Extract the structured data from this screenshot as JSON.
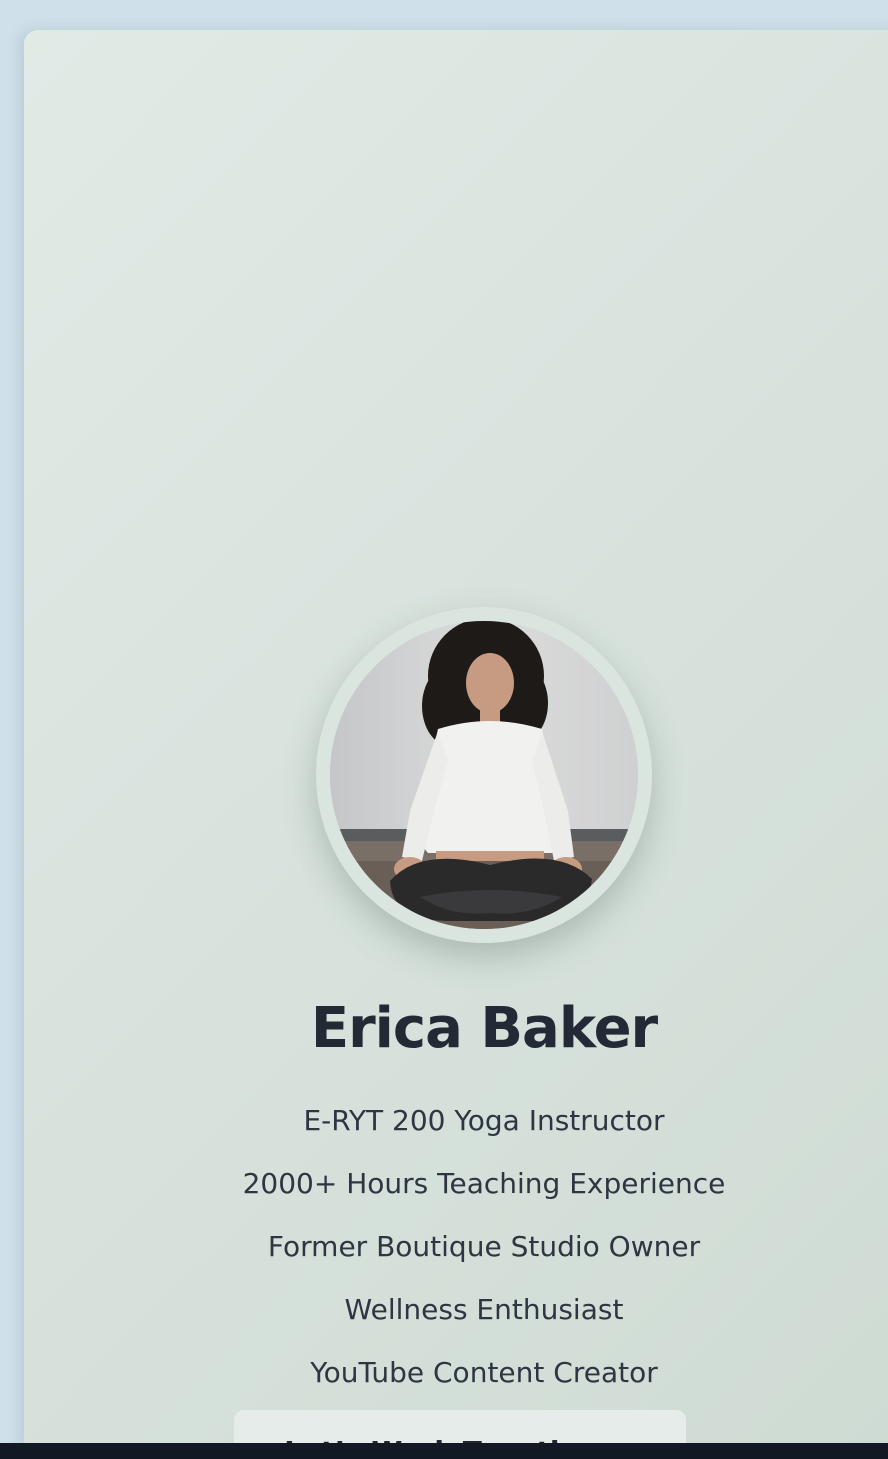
{
  "profile": {
    "name": "Erica Baker",
    "photo_icon": "profile-photo"
  },
  "credentials": [
    "E-RYT 200 Yoga Instructor",
    "2000+ Hours Teaching Experience",
    "Former Boutique Studio Owner",
    "Wellness Enthusiast",
    "YouTube Content Creator"
  ],
  "cta": {
    "label": "Let’s Work Together →"
  },
  "colors": {
    "page_bg": "#d0e0ea",
    "card_bg": "#dde7e2",
    "text_dark": "#232a36",
    "text_body": "#2f3641"
  }
}
